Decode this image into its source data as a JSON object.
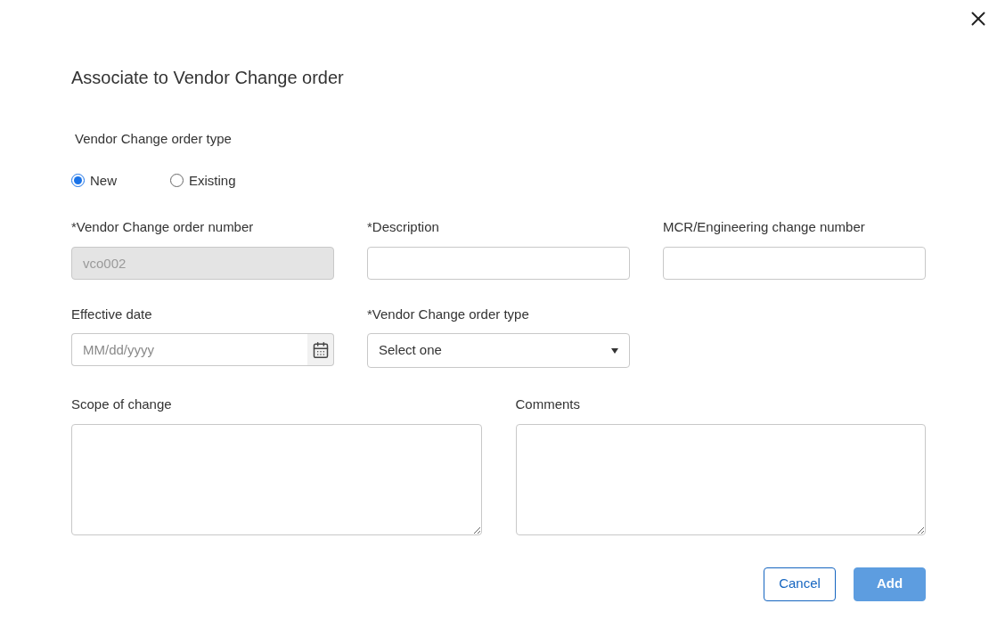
{
  "dialog": {
    "title": "Associate to Vendor Change order"
  },
  "order_type": {
    "label": "Vendor Change order type",
    "options": [
      {
        "label": "New",
        "selected": true
      },
      {
        "label": "Existing",
        "selected": false
      }
    ]
  },
  "field_rows": [
    [
      {
        "kind": "text",
        "label": "*Vendor Change order number",
        "value": "vco002",
        "disabled": true
      },
      {
        "kind": "text",
        "label": "*Description",
        "disabled": false
      },
      {
        "kind": "text",
        "label": "MCR/Engineering change number",
        "disabled": false
      }
    ],
    [
      {
        "kind": "date",
        "label": "Effective date",
        "placeholder": "MM/dd/yyyy"
      },
      {
        "kind": "select",
        "label": "*Vendor Change order type",
        "value": "Select one"
      }
    ]
  ],
  "text_areas": [
    {
      "label": "Scope of change"
    },
    {
      "label": "Comments"
    }
  ],
  "buttons": [
    {
      "kind": "secondary",
      "label": "Cancel",
      "disabled": false
    },
    {
      "kind": "primary",
      "label": "Add",
      "disabled": true
    }
  ]
}
